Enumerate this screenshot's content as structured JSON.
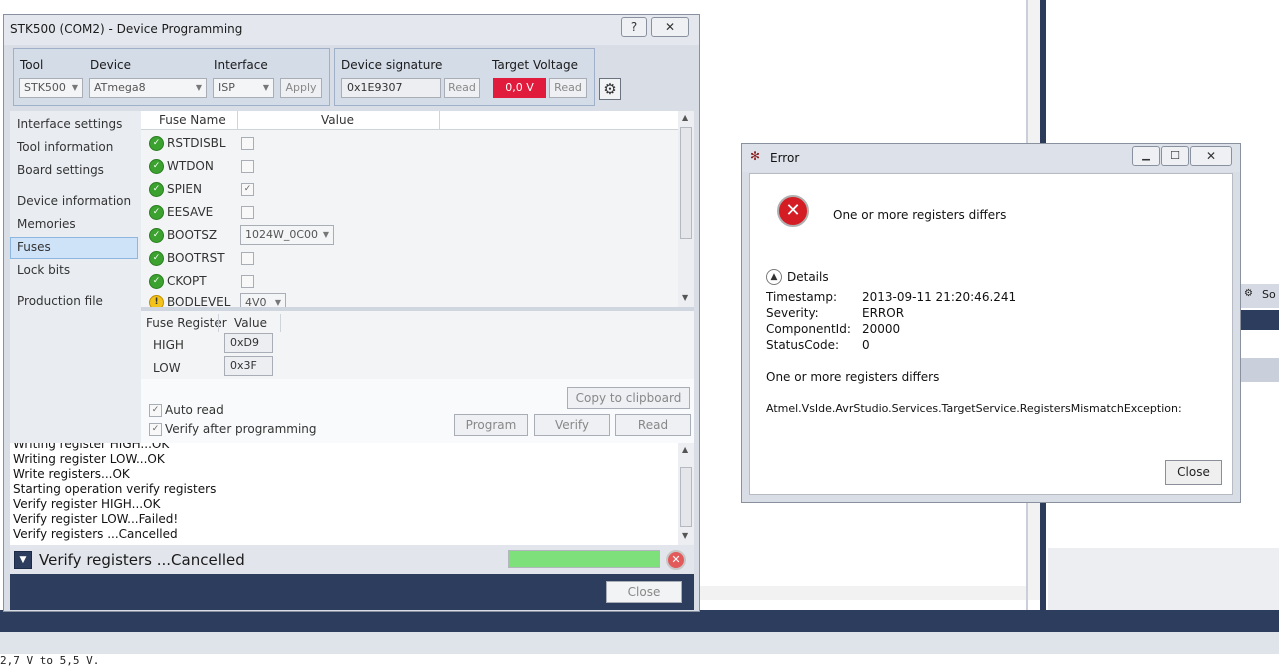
{
  "prog": {
    "title": "STK500 (COM2) - Device Programming",
    "help": "?",
    "close_x": "✕",
    "tool_label": "Tool",
    "tool_value": "STK500",
    "device_label": "Device",
    "device_value": "ATmega8",
    "interface_label": "Interface",
    "interface_value": "ISP",
    "apply": "Apply",
    "signature_label": "Device signature",
    "signature_value": "0x1E9307",
    "signature_read": "Read",
    "voltage_label": "Target Voltage",
    "voltage_value": "0,0 V",
    "voltage_read": "Read",
    "nav": [
      "Interface settings",
      "Tool information",
      "Board settings",
      "Device information",
      "Memories",
      "Fuses",
      "Lock bits",
      "Production file"
    ],
    "fuse_header_name": "Fuse Name",
    "fuse_header_value": "Value",
    "fuses": [
      {
        "name": "RSTDISBL",
        "status": "ok",
        "checked": false
      },
      {
        "name": "WTDON",
        "status": "ok",
        "checked": false
      },
      {
        "name": "SPIEN",
        "status": "ok",
        "checked": true
      },
      {
        "name": "EESAVE",
        "status": "ok",
        "checked": false
      },
      {
        "name": "BOOTSZ",
        "status": "ok",
        "value": "1024W_0C00"
      },
      {
        "name": "BOOTRST",
        "status": "ok",
        "checked": false
      },
      {
        "name": "CKOPT",
        "status": "ok",
        "checked": false
      },
      {
        "name": "BODLEVEL",
        "status": "warn",
        "value": "4V0"
      }
    ],
    "reg_header_name": "Fuse Register",
    "reg_header_value": "Value",
    "registers": [
      {
        "name": "HIGH",
        "value": "0xD9"
      },
      {
        "name": "LOW",
        "value": "0x3F"
      }
    ],
    "copy_clipboard": "Copy to clipboard",
    "auto_read": "Auto read",
    "verify_after": "Verify after programming",
    "program": "Program",
    "verify": "Verify",
    "read": "Read",
    "log": [
      "Writing register HIGH...OK",
      "Writing register LOW...OK",
      "Write registers...OK",
      "Starting operation verify registers",
      "Verify register HIGH...OK",
      "Verify register LOW...Failed!",
      "Verify registers ...Cancelled"
    ],
    "status": "Verify registers ...Cancelled",
    "close": "Close"
  },
  "error": {
    "title": "Error",
    "minimize": "▁",
    "maximize": "☐",
    "close_x": "✕",
    "message": "One or more registers differs",
    "details_label": "Details",
    "fields": [
      {
        "key": "Timestamp:",
        "value": "2013-09-11 21:20:46.241"
      },
      {
        "key": "Severity:",
        "value": "ERROR"
      },
      {
        "key": "ComponentId:",
        "value": "20000"
      },
      {
        "key": "StatusCode:",
        "value": "0"
      }
    ],
    "message2": "One or more registers differs",
    "exception": "Atmel.VsIde.AvrStudio.Services.TargetService.RegistersMismatchException:",
    "close": "Close"
  },
  "ide": {
    "side_tab": "So",
    "bottom_text": "2,7 V to 5,5 V."
  }
}
